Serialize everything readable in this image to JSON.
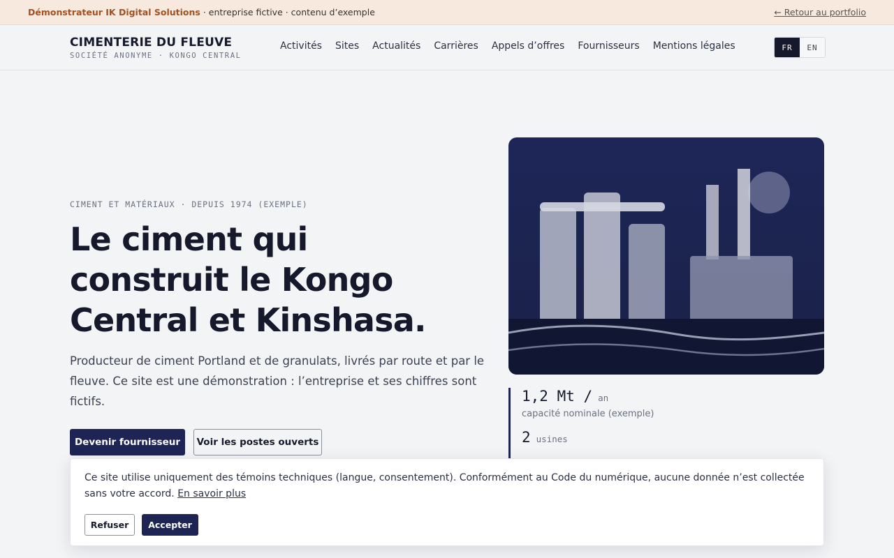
{
  "banner": {
    "brand": "Démonstrateur IK Digital Solutions",
    "tagline": " · entreprise fictive · contenu d’exemple",
    "back_link": "← Retour au portfolio"
  },
  "header": {
    "logo_name": "CIMENTERIE DU FLEUVE",
    "logo_sub": "SOCIÉTÉ ANONYME · KONGO CENTRAL",
    "nav": [
      "Activités",
      "Sites",
      "Actualités",
      "Carrières",
      "Appels d’offres",
      "Fournisseurs",
      "Mentions légales"
    ],
    "lang": {
      "active": "FR",
      "inactive": "EN"
    }
  },
  "hero": {
    "eyebrow": "CIMENT ET MATÉRIAUX · DEPUIS 1974 (EXEMPLE)",
    "headline": "Le ciment qui construit le Kongo Central et Kinshasa.",
    "lead": "Producteur de ciment Portland et de granulats, livrés par route et par le fleuve. Ce site est une démonstration : l’entreprise et ses chiffres sont fictifs.",
    "primary_button": "Devenir fournisseur",
    "secondary_button": "Voir les postes ouverts"
  },
  "stats": [
    {
      "value": "1,2 Mt /",
      "unit": "an",
      "caption": "capacité nominale (exemple)"
    },
    {
      "value": "2",
      "unit": "usines",
      "caption": ""
    }
  ],
  "cookie": {
    "text": "Ce site utilise uniquement des témoins techniques (langue, consentement). Conformément au Code du numérique, aucune donnée n’est collectée sans votre accord.",
    "link": "En savoir plus",
    "refuse": "Refuser",
    "accept": "Accepter"
  },
  "colors": {
    "brand_navy": "#1e2555",
    "banner_bg": "#f8e9df",
    "brand_orange": "#a4501f",
    "page_bg": "#f3f4f6"
  }
}
